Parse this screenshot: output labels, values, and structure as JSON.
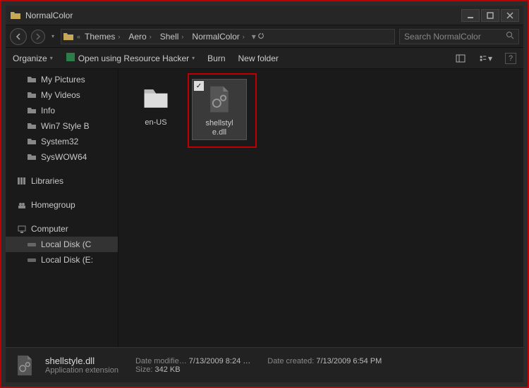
{
  "window": {
    "title": "NormalColor"
  },
  "breadcrumbs": {
    "items": [
      "Themes",
      "Aero",
      "Shell",
      "NormalColor"
    ]
  },
  "search": {
    "placeholder": "Search NormalColor"
  },
  "toolbar": {
    "organize": "Organize",
    "open_rh": "Open using Resource Hacker",
    "burn": "Burn",
    "new_folder": "New folder"
  },
  "sidebar": {
    "favorites": [
      {
        "label": "My Pictures"
      },
      {
        "label": "My Videos"
      },
      {
        "label": "Info"
      },
      {
        "label": "Win7 Style B"
      },
      {
        "label": "System32"
      },
      {
        "label": "SysWOW64"
      }
    ],
    "libraries_label": "Libraries",
    "homegroup_label": "Homegroup",
    "computer_label": "Computer",
    "drives": [
      {
        "label": "Local Disk (C",
        "selected": true
      },
      {
        "label": "Local Disk (E:"
      }
    ]
  },
  "files": {
    "items": [
      {
        "name": "en-US",
        "type": "folder",
        "selected": false
      },
      {
        "name": "shellstyle.dll",
        "type": "dll",
        "selected": true
      }
    ]
  },
  "details": {
    "name": "shellstyle.dll",
    "type": "Application extension",
    "date_modified_label": "Date modifie…",
    "date_modified": "7/13/2009 8:24 …",
    "date_created_label": "Date created:",
    "date_created": "7/13/2009 6:54 PM",
    "size_label": "Size:",
    "size": "342 KB"
  }
}
